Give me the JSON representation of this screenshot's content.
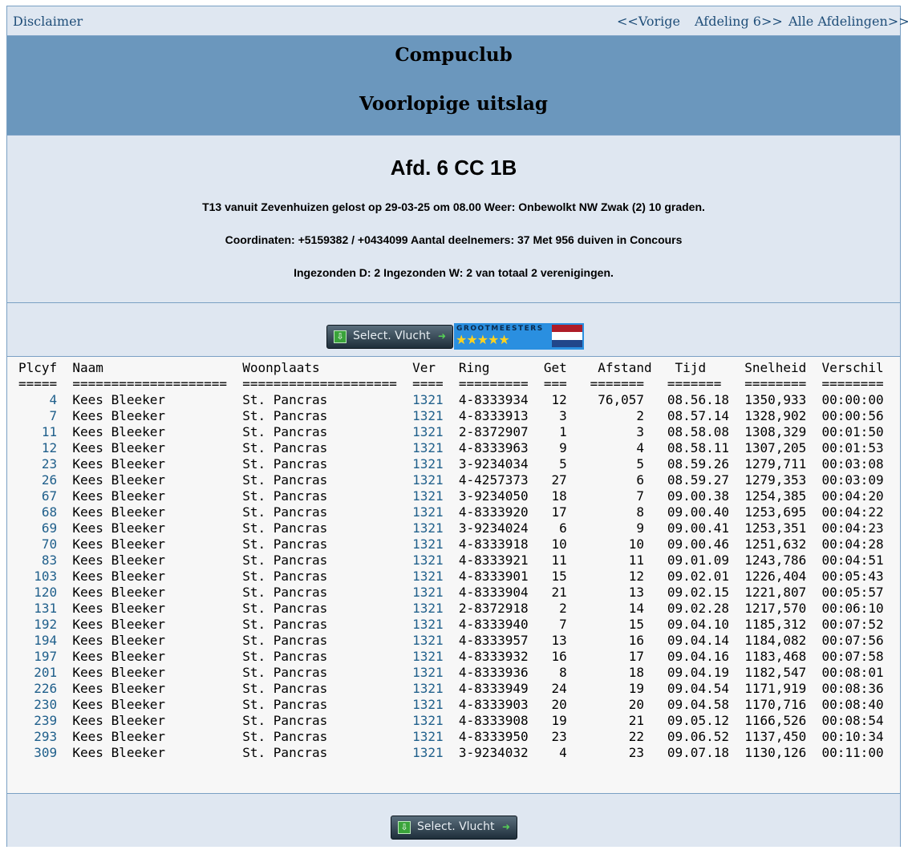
{
  "nav": {
    "disclaimer": "Disclaimer",
    "prev": "<<Vorige",
    "afdeling": "Afdeling 6>>",
    "alle": "Alle Afdelingen>>"
  },
  "header": {
    "club": "Compuclub",
    "subtitle": "Voorlopige uitslag"
  },
  "info": {
    "heading": "Afd. 6 CC 1B",
    "line1": "T13 vanuit Zevenhuizen gelost op 29-03-25 om 08.00 Weer: Onbewolkt NW Zwak (2) 10 graden.",
    "line2": "Coordinaten: +5159382 / +0434099 Aantal deelnemers: 37 Met 956 duiven in Concours",
    "line3": "Ingezonden D: 2 Ingezonden W: 2 van totaal 2 verenigingen."
  },
  "buttons": {
    "select_vlucht": "Select. Vlucht",
    "grootmeesters": "GROOTMEESTERS",
    "stars": "★★★★★"
  },
  "colors": {
    "link": "#1f5f8b",
    "header_bg": "#6b97bd",
    "panel_bg": "#dfe7f1",
    "flag_red": "#ae1c28",
    "flag_blue": "#21468b"
  },
  "table": {
    "headers": [
      "Plcyf",
      "Naam",
      "Woonplaats",
      "Ver",
      "Ring",
      "Get",
      "Afstand",
      "Tijd",
      "Snelheid",
      "Verschil"
    ],
    "separators": [
      "=====",
      "====================",
      "====================",
      "====",
      "=========",
      "===",
      "=======",
      "=======",
      "========",
      "========"
    ],
    "rows": [
      [
        "4",
        "Kees Bleeker",
        "St. Pancras",
        "1321",
        "4-8333934",
        "12",
        "76,057",
        "08.56.18",
        "1350,933",
        "00:00:00"
      ],
      [
        "7",
        "Kees Bleeker",
        "St. Pancras",
        "1321",
        "4-8333913",
        "3",
        "2",
        "08.57.14",
        "1328,902",
        "00:00:56"
      ],
      [
        "11",
        "Kees Bleeker",
        "St. Pancras",
        "1321",
        "2-8372907",
        "1",
        "3",
        "08.58.08",
        "1308,329",
        "00:01:50"
      ],
      [
        "12",
        "Kees Bleeker",
        "St. Pancras",
        "1321",
        "4-8333963",
        "9",
        "4",
        "08.58.11",
        "1307,205",
        "00:01:53"
      ],
      [
        "23",
        "Kees Bleeker",
        "St. Pancras",
        "1321",
        "3-9234034",
        "5",
        "5",
        "08.59.26",
        "1279,711",
        "00:03:08"
      ],
      [
        "26",
        "Kees Bleeker",
        "St. Pancras",
        "1321",
        "4-4257373",
        "27",
        "6",
        "08.59.27",
        "1279,353",
        "00:03:09"
      ],
      [
        "67",
        "Kees Bleeker",
        "St. Pancras",
        "1321",
        "3-9234050",
        "18",
        "7",
        "09.00.38",
        "1254,385",
        "00:04:20"
      ],
      [
        "68",
        "Kees Bleeker",
        "St. Pancras",
        "1321",
        "4-8333920",
        "17",
        "8",
        "09.00.40",
        "1253,695",
        "00:04:22"
      ],
      [
        "69",
        "Kees Bleeker",
        "St. Pancras",
        "1321",
        "3-9234024",
        "6",
        "9",
        "09.00.41",
        "1253,351",
        "00:04:23"
      ],
      [
        "70",
        "Kees Bleeker",
        "St. Pancras",
        "1321",
        "4-8333918",
        "10",
        "10",
        "09.00.46",
        "1251,632",
        "00:04:28"
      ],
      [
        "83",
        "Kees Bleeker",
        "St. Pancras",
        "1321",
        "4-8333921",
        "11",
        "11",
        "09.01.09",
        "1243,786",
        "00:04:51"
      ],
      [
        "103",
        "Kees Bleeker",
        "St. Pancras",
        "1321",
        "4-8333901",
        "15",
        "12",
        "09.02.01",
        "1226,404",
        "00:05:43"
      ],
      [
        "120",
        "Kees Bleeker",
        "St. Pancras",
        "1321",
        "4-8333904",
        "21",
        "13",
        "09.02.15",
        "1221,807",
        "00:05:57"
      ],
      [
        "131",
        "Kees Bleeker",
        "St. Pancras",
        "1321",
        "2-8372918",
        "2",
        "14",
        "09.02.28",
        "1217,570",
        "00:06:10"
      ],
      [
        "192",
        "Kees Bleeker",
        "St. Pancras",
        "1321",
        "4-8333940",
        "7",
        "15",
        "09.04.10",
        "1185,312",
        "00:07:52"
      ],
      [
        "194",
        "Kees Bleeker",
        "St. Pancras",
        "1321",
        "4-8333957",
        "13",
        "16",
        "09.04.14",
        "1184,082",
        "00:07:56"
      ],
      [
        "197",
        "Kees Bleeker",
        "St. Pancras",
        "1321",
        "4-8333932",
        "16",
        "17",
        "09.04.16",
        "1183,468",
        "00:07:58"
      ],
      [
        "201",
        "Kees Bleeker",
        "St. Pancras",
        "1321",
        "4-8333936",
        "8",
        "18",
        "09.04.19",
        "1182,547",
        "00:08:01"
      ],
      [
        "226",
        "Kees Bleeker",
        "St. Pancras",
        "1321",
        "4-8333949",
        "24",
        "19",
        "09.04.54",
        "1171,919",
        "00:08:36"
      ],
      [
        "230",
        "Kees Bleeker",
        "St. Pancras",
        "1321",
        "4-8333903",
        "20",
        "20",
        "09.04.58",
        "1170,716",
        "00:08:40"
      ],
      [
        "239",
        "Kees Bleeker",
        "St. Pancras",
        "1321",
        "4-8333908",
        "19",
        "21",
        "09.05.12",
        "1166,526",
        "00:08:54"
      ],
      [
        "293",
        "Kees Bleeker",
        "St. Pancras",
        "1321",
        "4-8333950",
        "23",
        "22",
        "09.06.52",
        "1137,450",
        "00:10:34"
      ],
      [
        "309",
        "Kees Bleeker",
        "St. Pancras",
        "1321",
        "3-9234032",
        "4",
        "23",
        "09.07.18",
        "1130,126",
        "00:11:00"
      ]
    ]
  }
}
